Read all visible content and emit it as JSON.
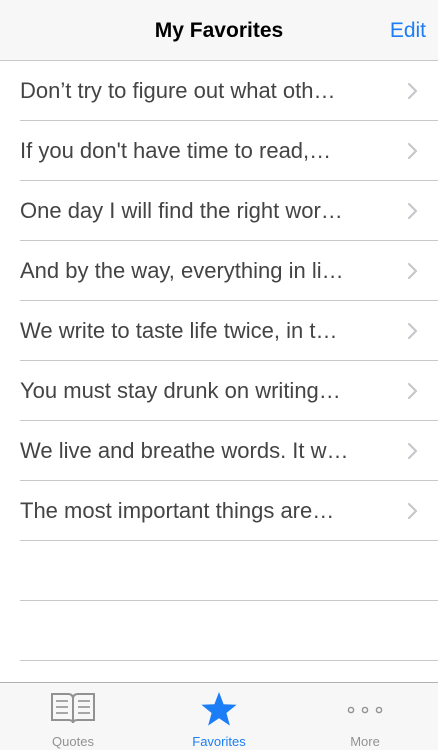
{
  "navbar": {
    "title": "My Favorites",
    "edit_label": "Edit"
  },
  "favorites": [
    "Don’t try to figure out what oth…",
    "If you don't have time to read,…",
    "One day I will find the right wor…",
    "And by the way, everything in li…",
    "We write to taste life twice, in t…",
    "You must stay drunk on writing…",
    "We live and breathe words. It w…",
    "The most important things are…"
  ],
  "tabbar": {
    "tabs": [
      {
        "label": "Quotes",
        "icon": "book-icon"
      },
      {
        "label": "Favorites",
        "icon": "star-icon",
        "active": true
      },
      {
        "label": "More",
        "icon": "more-dots-icon"
      }
    ]
  },
  "colors": {
    "accent": "#1b7ef6",
    "inactive": "#929292",
    "separator": "#c8c7cc"
  }
}
